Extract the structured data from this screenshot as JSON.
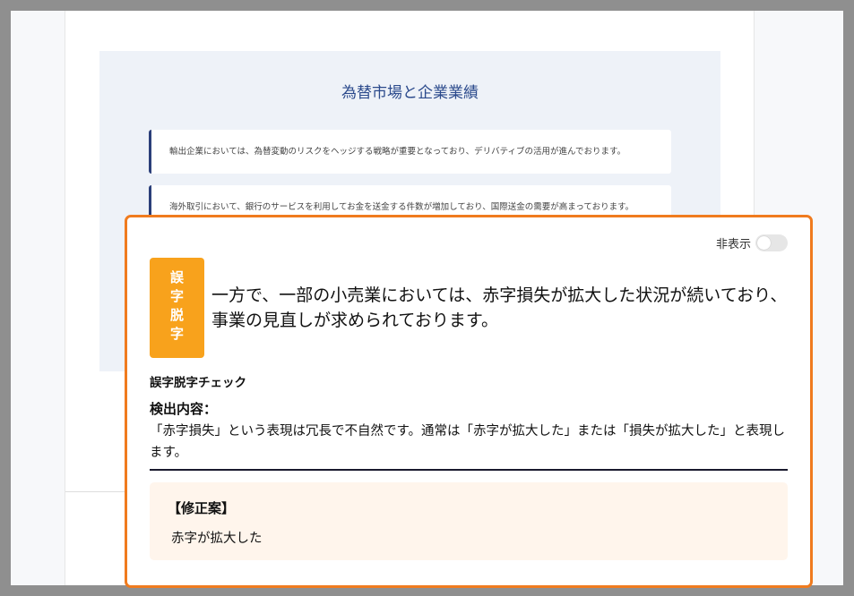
{
  "document": {
    "slide": {
      "title": "為替市場と企業業績",
      "cards": [
        "輸出企業においては、為替変動のリスクをヘッジする戦略が重要となっており、デリバティブの活用が進んでおります。",
        "海外取引において、銀行のサービスを利用してお金を送金する件数が増加しており、国際送金の需要が高まっております。"
      ]
    }
  },
  "panel": {
    "hide_label": "非表示",
    "toggle_on": false,
    "badge_label": "誤字脱字",
    "main_text": "一方で、一部の小売業においては、赤字損失が拡大した状況が続いており、事業の見直しが求められております。",
    "check_title": "誤字脱字チェック",
    "detect_label": "検出内容：",
    "detect_text": "「赤字損失」という表現は冗長で不自然です。通常は「赤字が拡大した」または「損失が拡大した」と表現します。",
    "suggestion_label": "【修正案】",
    "suggestion_text": "赤字が拡大した"
  },
  "colors": {
    "panel_border": "#f07b1e",
    "badge": "#f8a21c",
    "slide_title": "#2b4a8c",
    "suggestion_bg": "#fff5ec"
  }
}
